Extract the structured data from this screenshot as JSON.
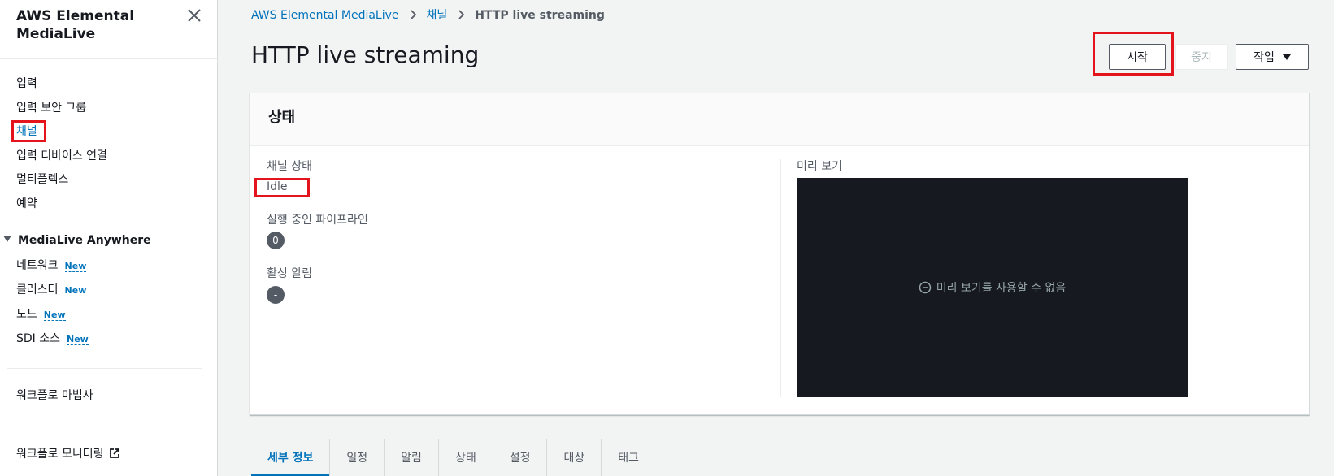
{
  "sidebar": {
    "title": "AWS Elemental MediaLive",
    "items": [
      {
        "label": "입력"
      },
      {
        "label": "입력 보안 그룹"
      },
      {
        "label": "채널"
      },
      {
        "label": "입력 디바이스 연결"
      },
      {
        "label": "멀티플렉스"
      },
      {
        "label": "예약"
      }
    ],
    "section": {
      "label": "MediaLive Anywhere",
      "items": [
        {
          "label": "네트워크",
          "badge": "New"
        },
        {
          "label": "클러스터",
          "badge": "New"
        },
        {
          "label": "노드",
          "badge": "New"
        },
        {
          "label": "SDI 소스",
          "badge": "New"
        }
      ]
    },
    "wizard": "워크플로 마법사",
    "monitoring": "워크플로 모니터링"
  },
  "breadcrumb": {
    "root": "AWS Elemental MediaLive",
    "channels": "채널",
    "current": "HTTP live streaming"
  },
  "page_title": "HTTP live streaming",
  "actions": {
    "start": "시작",
    "stop": "중지",
    "action": "작업"
  },
  "status_panel": {
    "title": "상태",
    "channel_state_label": "채널 상태",
    "channel_state_value": "Idle",
    "running_pipelines_label": "실행 중인 파이프라인",
    "running_pipelines_value": "0",
    "active_alerts_label": "활성 알림",
    "active_alerts_value": "-",
    "preview_label": "미리 보기",
    "preview_unavailable": "미리 보기를 사용할 수 없음"
  },
  "tabs": [
    {
      "label": "세부 정보",
      "active": true
    },
    {
      "label": "일정"
    },
    {
      "label": "알림"
    },
    {
      "label": "상태"
    },
    {
      "label": "설정"
    },
    {
      "label": "대상"
    },
    {
      "label": "태그"
    }
  ],
  "colors": {
    "link": "#0073bb",
    "highlight": "#e3141b",
    "preview_bg": "#16191f"
  }
}
